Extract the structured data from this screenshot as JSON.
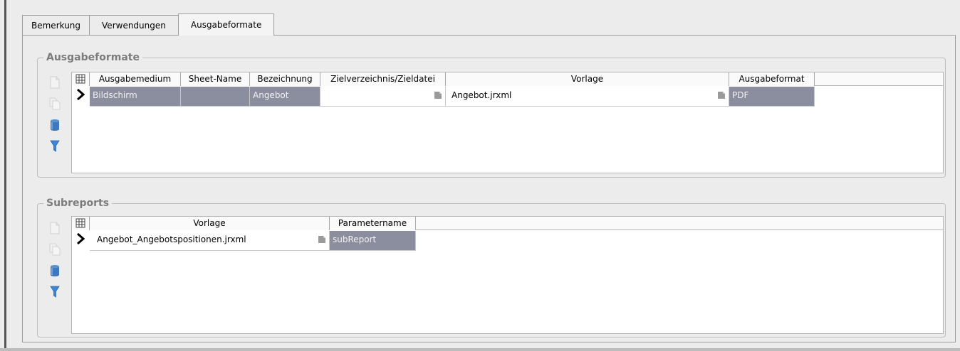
{
  "tabs": [
    {
      "label": "Bemerkung"
    },
    {
      "label": "Verwendungen"
    },
    {
      "label": "Ausgabeformate"
    }
  ],
  "ausgabeformate": {
    "title": "Ausgabeformate",
    "columns": [
      "Ausgabemedium",
      "Sheet-Name",
      "Bezeichnung",
      "Zielverzeichnis/Zieldatei",
      "Vorlage",
      "Ausgabeformat"
    ],
    "rows": [
      {
        "ausgabemedium": "Bildschirm",
        "sheet_name": "",
        "bezeichnung": "Angebot",
        "zielverzeichnis": "",
        "vorlage": "Angebot.jrxml",
        "ausgabeformat": "PDF"
      }
    ]
  },
  "subreports": {
    "title": "Subreports",
    "columns": [
      "Vorlage",
      "Parametername"
    ],
    "rows": [
      {
        "vorlage": "Angebot_Angebotspositionen.jrxml",
        "parametername": "subReport"
      }
    ]
  },
  "toolbar_icons": [
    "new-record-icon",
    "copy-record-icon",
    "delete-record-icon",
    "filter-icon"
  ],
  "colors": {
    "selected_cell": "#8a8e9e",
    "filter_blue": "#3d86d6",
    "group_title": "#7c7c7c"
  }
}
